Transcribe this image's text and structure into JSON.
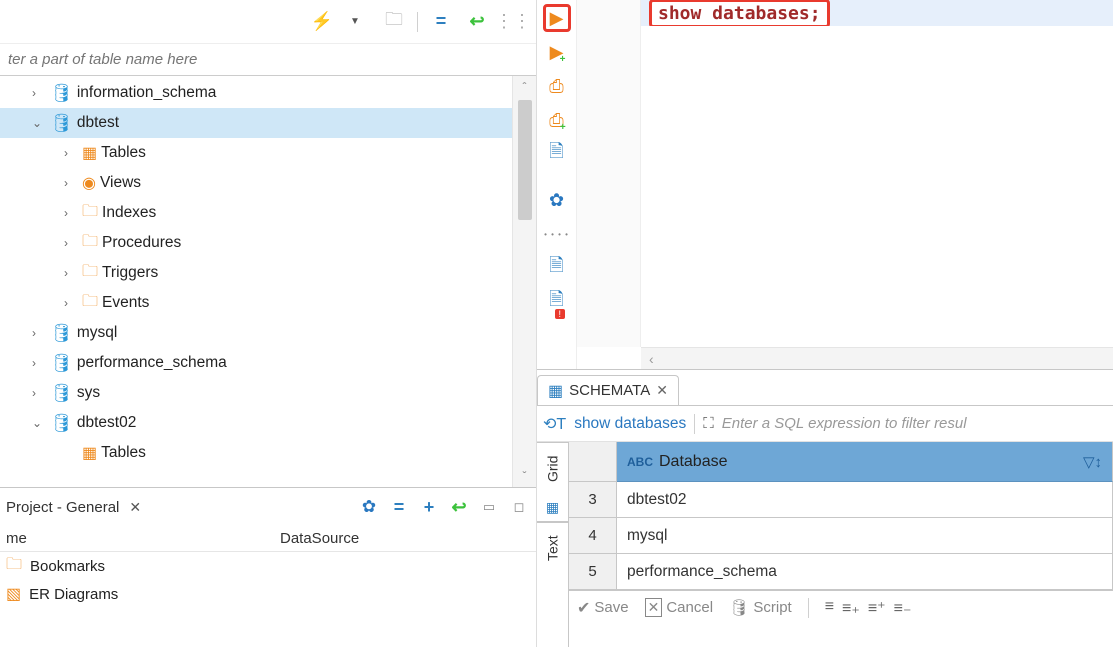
{
  "filter": {
    "placeholder": "ter a part of table name here"
  },
  "tree": {
    "items": [
      {
        "label": "information_schema"
      },
      {
        "label": "dbtest"
      },
      {
        "label": "Tables"
      },
      {
        "label": "Views"
      },
      {
        "label": "Indexes"
      },
      {
        "label": "Procedures"
      },
      {
        "label": "Triggers"
      },
      {
        "label": "Events"
      },
      {
        "label": "mysql"
      },
      {
        "label": "performance_schema"
      },
      {
        "label": "sys"
      },
      {
        "label": "dbtest02"
      },
      {
        "label": "Tables"
      }
    ]
  },
  "project": {
    "title": "Project - General",
    "cols": {
      "name": "me",
      "ds": "DataSource"
    },
    "items": [
      {
        "label": "Bookmarks"
      },
      {
        "label": "ER Diagrams"
      }
    ]
  },
  "editor": {
    "sql": "show databases;"
  },
  "results": {
    "tab": "SCHEMATA",
    "query": "show databases",
    "filter_hint": "Enter a SQL expression to filter resul",
    "column": "Database",
    "rows": [
      {
        "n": "3",
        "v": "dbtest02"
      },
      {
        "n": "4",
        "v": "mysql"
      },
      {
        "n": "5",
        "v": "performance_schema"
      }
    ],
    "grid_tab": "Grid",
    "text_tab": "Text",
    "footer": {
      "save": "Save",
      "cancel": "Cancel",
      "script": "Script"
    }
  }
}
